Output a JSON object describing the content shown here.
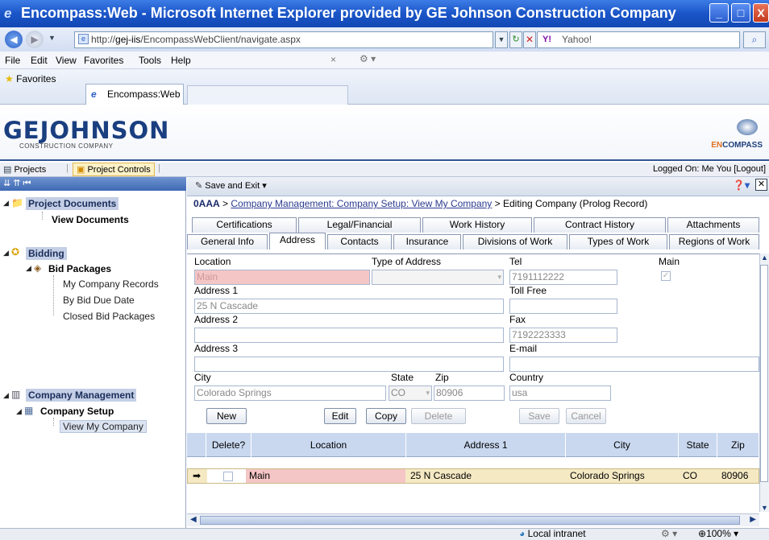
{
  "window": {
    "title": "Encompass:Web - Microsoft Internet Explorer provided by GE Johnson Construction Company"
  },
  "browser": {
    "url_prefix": "http://",
    "url_domain": "gej-iis",
    "url_path": "/EncompassWebClient/navigate.aspx",
    "search_placeholder": "Yahoo!",
    "menu": [
      "File",
      "Edit",
      "View",
      "Favorites",
      "Tools",
      "Help"
    ],
    "favorites_label": "Favorites",
    "tab_title": "Encompass:Web"
  },
  "banner": {
    "logo": "GEJOHNSON",
    "logo_sub": "CONSTRUCTION COMPANY",
    "product_en": "EN",
    "product_rest": "COMPASS"
  },
  "appbar": {
    "tab_projects": "Projects",
    "tab_project_controls": "Project Controls",
    "logged_on": "Logged On: Me You  [Logout]"
  },
  "tree": {
    "project_documents": "Project Documents",
    "view_documents": "View Documents",
    "bidding": "Bidding",
    "bid_packages": "Bid Packages",
    "my_company_records": "My Company Records",
    "by_bid_due_date": "By Bid Due Date",
    "closed_bid_packages": "Closed Bid Packages",
    "company_management": "Company Management",
    "company_setup": "Company Setup",
    "view_my_company": "View My Company"
  },
  "toolbar": {
    "save_exit": "Save and Exit"
  },
  "breadcrumb": {
    "root": "0AAA",
    "sep1": " > ",
    "link": "Company Management: Company Setup: View My Company",
    "sep2": " > ",
    "current": "Editing Company (Prolog Record)"
  },
  "tabs_row1": [
    "Certifications",
    "Legal/Financial",
    "Work History",
    "Contract History",
    "Attachments"
  ],
  "tabs_row2": [
    "General Info",
    "Address",
    "Contacts",
    "Insurance",
    "Divisions of Work",
    "Types of Work",
    "Regions of Work"
  ],
  "form": {
    "location_label": "Location",
    "location_value": "Main",
    "type_label": "Type of Address",
    "type_value": "",
    "tel_label": "Tel",
    "tel_value": "7191112222",
    "main_label": "Main",
    "address1_label": "Address 1",
    "address1_value": "25 N Cascade",
    "tollfree_label": "Toll Free",
    "tollfree_value": "",
    "address2_label": "Address 2",
    "address2_value": "",
    "fax_label": "Fax",
    "fax_value": "7192223333",
    "address3_label": "Address 3",
    "address3_value": "",
    "email_label": "E-mail",
    "email_value": "",
    "city_label": "City",
    "city_value": "Colorado Springs",
    "state_label": "State",
    "state_value": "CO",
    "zip_label": "Zip",
    "zip_value": "80906",
    "country_label": "Country",
    "country_value": "usa"
  },
  "buttons": {
    "new": "New",
    "edit": "Edit",
    "copy": "Copy",
    "delete": "Delete",
    "save": "Save",
    "cancel": "Cancel"
  },
  "grid": {
    "columns": [
      "Delete?",
      "Location",
      "Address 1",
      "City",
      "State",
      "Zip"
    ],
    "rows": [
      {
        "location": "Main",
        "address1": "25 N Cascade",
        "city": "Colorado Springs",
        "state": "CO",
        "zip": "80906"
      }
    ]
  },
  "status": {
    "zone": "Local intranet",
    "zoom": "100%"
  }
}
